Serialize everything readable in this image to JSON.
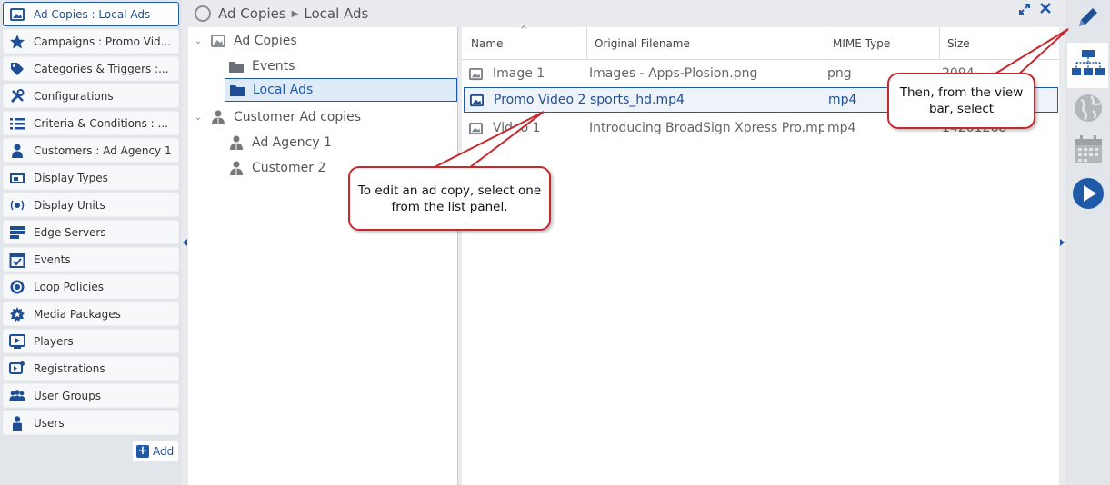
{
  "sidebar": {
    "items": [
      {
        "label": "Ad Copies : Local Ads",
        "icon": "image-icon",
        "active": true
      },
      {
        "label": "Campaigns : Promo Vid...",
        "icon": "star-icon"
      },
      {
        "label": "Categories & Triggers :...",
        "icon": "tag-icon"
      },
      {
        "label": "Configurations",
        "icon": "tools-icon"
      },
      {
        "label": "Criteria & Conditions : ...",
        "icon": "list-icon"
      },
      {
        "label": "Customers : Ad Agency 1",
        "icon": "customer-icon"
      },
      {
        "label": "Display Types",
        "icon": "display-types-icon"
      },
      {
        "label": "Display Units",
        "icon": "display-unit-icon"
      },
      {
        "label": "Edge Servers",
        "icon": "server-icon"
      },
      {
        "label": "Events",
        "icon": "calendar-check-icon"
      },
      {
        "label": "Loop Policies",
        "icon": "loop-icon"
      },
      {
        "label": "Media Packages",
        "icon": "package-icon"
      },
      {
        "label": "Players",
        "icon": "player-icon"
      },
      {
        "label": "Registrations",
        "icon": "registration-icon"
      },
      {
        "label": "User Groups",
        "icon": "user-group-icon"
      },
      {
        "label": "Users",
        "icon": "user-icon"
      }
    ],
    "add_label": "Add"
  },
  "header": {
    "crumb_root": "Ad Copies",
    "crumb_current": "Local Ads"
  },
  "tree": {
    "nodes": [
      {
        "label": "Ad Copies",
        "icon": "image-icon",
        "toggle": "expanded"
      },
      {
        "label": "Events",
        "icon": "folder-icon"
      },
      {
        "label": "Local Ads",
        "icon": "folder-icon",
        "selected": true
      },
      {
        "label": "Customer Ad copies",
        "icon": "customer-icon",
        "toggle": "expanded"
      },
      {
        "label": "Ad Agency 1",
        "icon": "customer-icon"
      },
      {
        "label": "Customer 2",
        "icon": "customer-icon"
      }
    ]
  },
  "list": {
    "columns": [
      "Name",
      "Original Filename",
      "MIME Type",
      "Size"
    ],
    "rows": [
      {
        "name": "Image 1",
        "filename": "Images - Apps-Plosion.png",
        "mime": "png",
        "size": "2094"
      },
      {
        "name": "Promo Video 2",
        "filename": "sports_hd.mp4",
        "mime": "mp4",
        "size": "",
        "selected": true
      },
      {
        "name": "Video 1",
        "filename": "Introducing BroadSign Xpress Pro.mp4",
        "mime": "mp4",
        "size": "14201268"
      }
    ]
  },
  "viewbar": {
    "buttons": [
      "pencil-icon",
      "hierarchy-icon",
      "globe-icon",
      "calendar-icon",
      "play-icon"
    ]
  },
  "callouts": {
    "edit": "To edit an ad copy, select one from the list panel.",
    "viewbar": "Then, from the view bar, select"
  },
  "colors": {
    "accent": "#1e5aa8",
    "callout_border": "#c8282d"
  }
}
